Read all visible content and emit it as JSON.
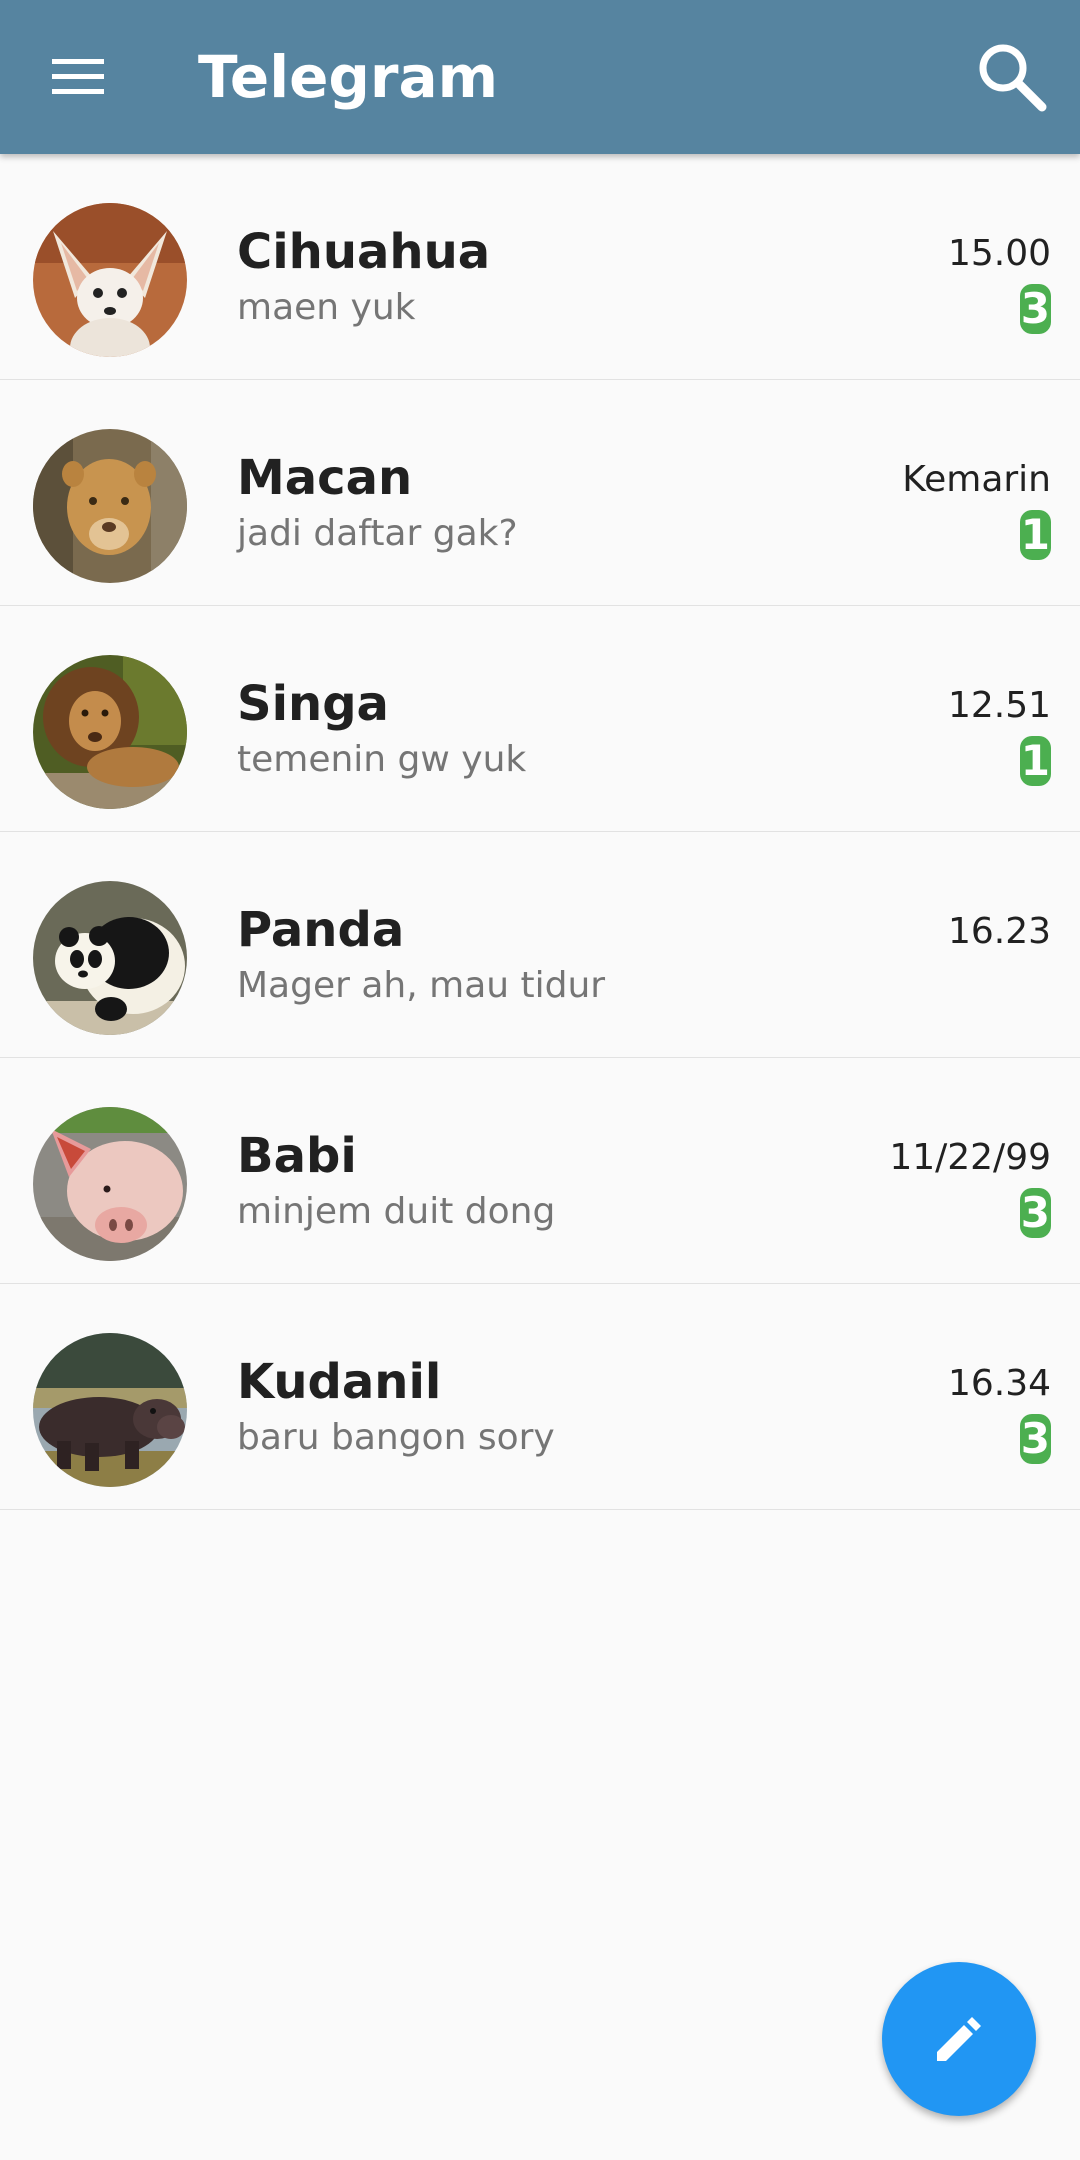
{
  "appbar": {
    "title": "Telegram",
    "menu_icon": "menu-icon",
    "search_icon": "search-icon",
    "color": "#5684a0"
  },
  "chats": [
    {
      "name": "Cihuahua",
      "message": "maen yuk",
      "time": "15.00",
      "unread": "3",
      "avatar": "fennec-fox-avatar"
    },
    {
      "name": "Macan",
      "message": "jadi daftar gak?",
      "time": "Kemarin",
      "unread": "1",
      "avatar": "lioness-avatar"
    },
    {
      "name": "Singa",
      "message": "temenin gw yuk",
      "time": "12.51",
      "unread": "1",
      "avatar": "lion-avatar"
    },
    {
      "name": "Panda",
      "message": "Mager ah, mau tidur",
      "time": "16.23",
      "unread": "",
      "avatar": "panda-avatar"
    },
    {
      "name": "Babi",
      "message": "minjem duit dong",
      "time": "11/22/99",
      "unread": "3",
      "avatar": "pig-avatar"
    },
    {
      "name": "Kudanil",
      "message": "baru bangon sory",
      "time": "16.34",
      "unread": "3",
      "avatar": "hippo-avatar"
    }
  ],
  "fab": {
    "icon": "pencil-icon",
    "color": "#2196f3"
  },
  "colors": {
    "badge": "#4caf50",
    "background": "#fafafa"
  }
}
